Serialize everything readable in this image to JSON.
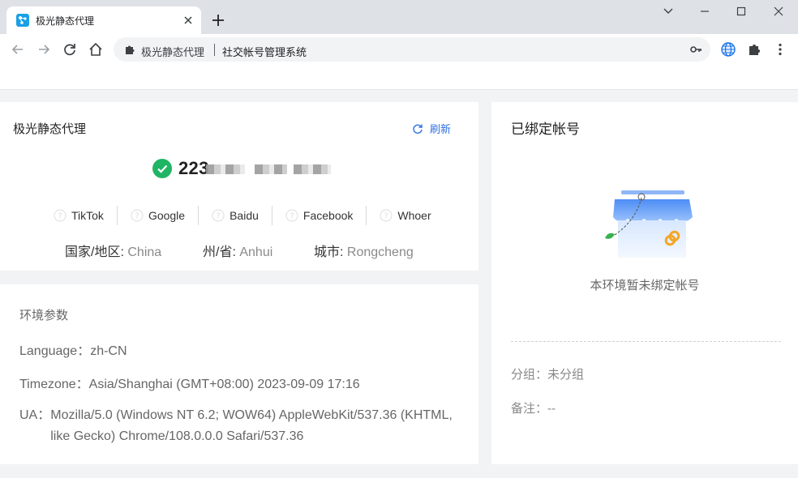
{
  "browser": {
    "tab_title": "极光静态代理",
    "omnibox_site": "极光静态代理",
    "omnibox_title": "社交帐号管理系统"
  },
  "ip_card": {
    "title": "极光静态代理",
    "refresh_label": "刷新",
    "ip_visible": "223",
    "checks": [
      {
        "label": "TikTok"
      },
      {
        "label": "Google"
      },
      {
        "label": "Baidu"
      },
      {
        "label": "Facebook"
      },
      {
        "label": "Whoer"
      }
    ],
    "geo": {
      "country_label": "国家/地区:",
      "country": "China",
      "state_label": "州/省:",
      "state": "Anhui",
      "city_label": "城市:",
      "city": "Rongcheng"
    }
  },
  "env": {
    "title": "环境参数",
    "language_label": "Language：",
    "language": "zh-CN",
    "timezone_label": "Timezone：",
    "timezone": "Asia/Shanghai (GMT+08:00) 2023-09-09 17:16",
    "ua_label": "UA：",
    "ua": "Mozilla/5.0 (Windows NT 6.2; WOW64) AppleWebKit/537.36 (KHTML, like Gecko) Chrome/108.0.0.0 Safari/537.36"
  },
  "accounts": {
    "title": "已绑定帐号",
    "empty_text": "本环境暂未绑定帐号",
    "group_label": "分组：",
    "group": "未分组",
    "note_label": "备注：",
    "note": "--"
  },
  "colors": {
    "accent": "#2f6fe0",
    "success": "#1fb564",
    "favicon": "#1aa0e6"
  }
}
